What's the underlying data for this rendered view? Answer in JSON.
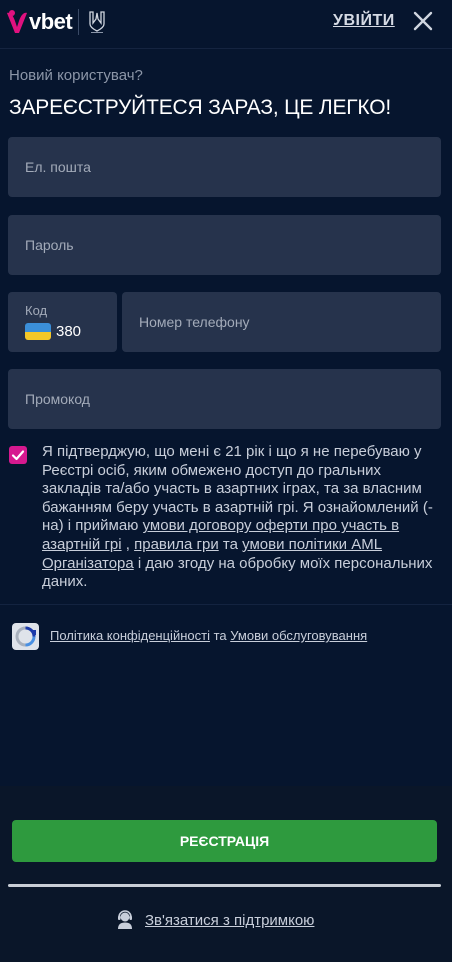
{
  "header": {
    "logo_text": "vbet",
    "login_label": "УВІЙТИ"
  },
  "intro": {
    "subtitle": "Новий користувач?",
    "title": "ЗАРЕЄСТРУЙТЕСЯ ЗАРАЗ, ЦЕ ЛЕГКО!"
  },
  "form": {
    "email_placeholder": "Ел. пошта",
    "password_placeholder": "Пароль",
    "code_label": "Код",
    "country_code": "380",
    "phone_placeholder": "Номер телефону",
    "promo_placeholder": "Промокод"
  },
  "terms": {
    "checked": true,
    "text_1": "Я підтверджую, що мені є 21 рік і що я не перебуваю у Реєстрі осіб, яким обмежено доступ до гральних закладів та/або участь в азартних іграх, та за власним бажанням беру участь в азартній грі. Я ознайомлений (-на) і приймаю ",
    "link_1": "умови договору оферти про участь в азартній грі",
    "text_2": " , ",
    "link_2": "правила гри",
    "text_3": " та ",
    "link_3": "умови політики AML Організатора",
    "text_4": " і даю згоду на обробку моїх персональних даних."
  },
  "policy": {
    "privacy_link": "Політика конфіденційності",
    "and": " та ",
    "terms_link": "Умови обслуговування"
  },
  "footer": {
    "register_label": "РЕЄСТРАЦІЯ",
    "support_label": "Зв'язатися з підтримкою"
  },
  "colors": {
    "background": "#06152e",
    "field": "#26334c",
    "checkbox": "#d6198f",
    "register_button": "#2e9a3e"
  }
}
